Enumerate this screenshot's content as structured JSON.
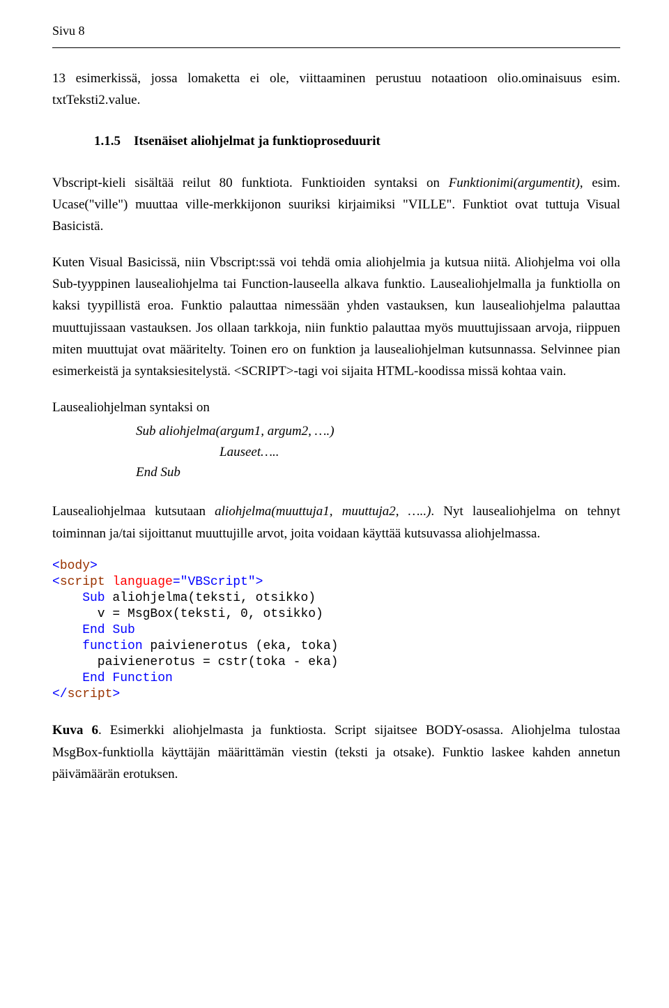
{
  "header": {
    "page_label": "Sivu 8"
  },
  "p1": "13 esimerkissä, jossa lomaketta ei ole, viittaaminen perustuu notaatioon olio.ominaisuus esim. txtTeksti2.value.",
  "section_number": "1.1.5",
  "section_title": "Itsenäiset aliohjelmat ja funktioproseduurit",
  "p2a": "Vbscript-kieli sisältää reilut 80 funktiota. Funktioiden syntaksi on ",
  "p2_em": "Funktionimi(argumentit)",
  "p2b": ", esim. Ucase(\"ville\") muuttaa ville-merkkijonon suuriksi kirjaimiksi \"VILLE\". Funktiot ovat tuttuja Visual Basicistä.",
  "p3": "Kuten Visual Basicissä, niin Vbscript:ssä voi tehdä omia aliohjelmia ja kutsua niitä. Aliohjelma voi olla Sub-tyyppinen lausealiohjelma tai Function-lauseella alkava funktio. Lausealiohjelmalla ja funktiolla on kaksi tyypillistä eroa. Funktio palauttaa nimessään yhden vastauksen, kun lausealiohjelma palauttaa muuttujissaan vastauksen. Jos ollaan tarkkoja, niin funktio palauttaa myös muuttujissaan arvoja, riippuen miten muuttujat ovat määritelty. Toinen ero on funktion ja lausealiohjelman kutsunnassa. Selvinnee pian esimerkeistä ja syntaksiesitelystä. <SCRIPT>-tagi voi sijaita HTML-koodissa missä kohtaa vain.",
  "p4": "Lausealiohjelman syntaksi on",
  "syntax": {
    "l1": "Sub aliohjelma(argum1, argum2, ….)",
    "l2": "Lauseet…..",
    "l3": "End Sub"
  },
  "p5a": "Lausealiohjelmaa kutsutaan ",
  "p5_em": "aliohjelma(muuttuja1, muuttuja2, …..)",
  "p5b": ". Nyt lausealiohjelma on tehnyt toiminnan ja/tai sijoittanut muuttujille arvot, joita voidaan käyttää kutsuvassa aliohjelmassa.",
  "code": {
    "l1a": "<",
    "l1b": "body",
    "l1c": ">",
    "l2a": "<",
    "l2b": "script",
    "l2c": " ",
    "l2d": "language",
    "l2e": "=\"VBScript\">",
    "l3a": "    Sub",
    "l3b": " aliohjelma(teksti, otsikko)",
    "l4": "      v = MsgBox(teksti, 0, otsikko)",
    "l5a": "    End",
    "l5b": " ",
    "l5c": "Sub",
    "l6a": "    function",
    "l6b": " paivienerotus (eka, toka)",
    "l7": "      paivienerotus = cstr(toka - eka)",
    "l8a": "    End",
    "l8b": " ",
    "l8c": "Function",
    "l9a": "</",
    "l9b": "script",
    "l9c": ">"
  },
  "caption_label": "Kuva 6",
  "caption_text": ". Esimerkki aliohjelmasta ja funktiosta. Script sijaitsee BODY-osassa. Aliohjelma tulostaa MsgBox-funktiolla käyttäjän määrittämän viestin (teksti ja otsake). Funktio laskee kahden annetun päivämäärän erotuksen."
}
